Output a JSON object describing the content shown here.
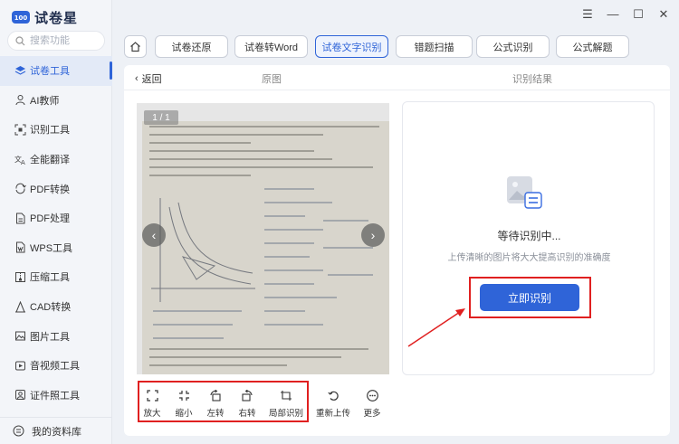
{
  "app": {
    "title": "试卷星"
  },
  "search": {
    "placeholder": "搜索功能"
  },
  "sidebar": {
    "items": [
      {
        "label": "试卷工具",
        "icon": "layers-icon",
        "active": true
      },
      {
        "label": "AI教师",
        "icon": "teacher-icon"
      },
      {
        "label": "识别工具",
        "icon": "scan-icon"
      },
      {
        "label": "全能翻译",
        "icon": "translate-icon"
      },
      {
        "label": "PDF转换",
        "icon": "convert-icon"
      },
      {
        "label": "PDF处理",
        "icon": "pdf-icon"
      },
      {
        "label": "WPS工具",
        "icon": "wps-icon"
      },
      {
        "label": "压缩工具",
        "icon": "compress-icon"
      },
      {
        "label": "CAD转换",
        "icon": "cad-icon"
      },
      {
        "label": "图片工具",
        "icon": "image-icon"
      },
      {
        "label": "音视频工具",
        "icon": "media-icon"
      },
      {
        "label": "证件照工具",
        "icon": "id-photo-icon"
      }
    ],
    "library": "我的资料库"
  },
  "tabs": [
    {
      "label": "试卷还原"
    },
    {
      "label": "试卷转Word"
    },
    {
      "label": "试卷文字识别",
      "active": true
    },
    {
      "label": "错题扫描"
    },
    {
      "label": "公式识别"
    },
    {
      "label": "公式解题"
    }
  ],
  "subheader": {
    "back": "返回",
    "original": "原图",
    "result": "识别结果"
  },
  "preview": {
    "page_indicator": "1 / 1"
  },
  "result": {
    "title": "等待识别中...",
    "hint": "上传清晰的图片将大大提高识别的准确度",
    "button": "立即识别"
  },
  "toolbar": [
    {
      "label": "放大",
      "icon": "expand-icon"
    },
    {
      "label": "缩小",
      "icon": "shrink-icon"
    },
    {
      "label": "左转",
      "icon": "rotate-left-icon"
    },
    {
      "label": "右转",
      "icon": "rotate-right-icon"
    },
    {
      "label": "局部识别",
      "icon": "crop-icon"
    },
    {
      "label": "重新上传",
      "icon": "reupload-icon"
    },
    {
      "label": "更多",
      "icon": "more-icon"
    }
  ],
  "colors": {
    "accent": "#2f64d8",
    "highlight": "#e02020"
  }
}
